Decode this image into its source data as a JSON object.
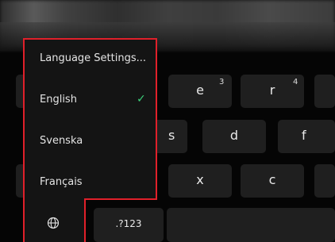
{
  "keyboard": {
    "row1": [
      {
        "label": "e",
        "sup": "3"
      },
      {
        "label": "r",
        "sup": "4"
      }
    ],
    "row2": [
      {
        "label": "s"
      },
      {
        "label": "d"
      },
      {
        "label": "f"
      }
    ],
    "row3": [
      {
        "label": "x"
      },
      {
        "label": "c"
      }
    ],
    "bottom": {
      "symbols_label": ".?123"
    }
  },
  "language_menu": {
    "settings_label": "Language Settings...",
    "items": [
      {
        "label": "English",
        "selected": true
      },
      {
        "label": "Svenska",
        "selected": false
      },
      {
        "label": "Français",
        "selected": false
      }
    ],
    "check_icon": "checkmark-icon",
    "globe_icon": "globe-icon",
    "highlight_color": "#e0202a",
    "check_color": "#3bd07a"
  }
}
